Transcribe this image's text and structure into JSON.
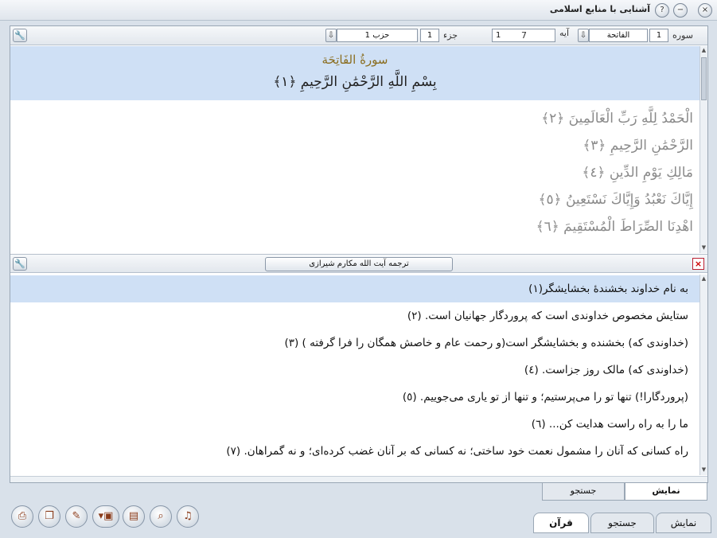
{
  "window": {
    "title": "آشنایی با منابع اسلامی"
  },
  "quran_toolbar": {
    "surah_label": "سوره",
    "surah_number": "1",
    "surah_name": "الفاتحة",
    "ayah_label": "آیه",
    "ayah_value": "1",
    "ayah_total": "7",
    "juz_label": "جزء",
    "juz_value": "1",
    "hizb_value": "حزب 1"
  },
  "quran": {
    "surah_title": "سورةُ الفَاتِحَة",
    "basmala": "بِسْمِ اللَّهِ الرَّحْمَٰنِ الرَّحِيمِ ﴿١﴾",
    "ayat": [
      "الْحَمْدُ لِلَّهِ رَبِّ الْعَالَمِينَ ﴿٢﴾",
      "الرَّحْمَٰنِ الرَّحِيمِ ﴿٣﴾",
      "مَالِكِ يَوْمِ الدِّينِ ﴿٤﴾",
      "إِيَّاكَ نَعْبُدُ وَإِيَّاكَ نَسْتَعِينُ ﴿٥﴾",
      "اهْدِنَا الصِّرَاطَ الْمُسْتَقِيمَ ﴿٦﴾"
    ]
  },
  "translation": {
    "translator": "ترجمه آیت الله مکارم شیرازی",
    "lines": [
      "به نام خداوند بخشندهٔ بخشایشگر(١)",
      "ستایش مخصوص خداوندی است که پروردگار جهانیان است. (٢)",
      "(خداوندی که) بخشنده و بخشایشگر است(و رحمت عام و خاصش همگان را فرا گرفته ) (٣)",
      "(خداوندی که) مالک روز جزاست. (٤)",
      "(پروردگارا!) تنها تو را می‌پرستیم؛ و تنها از تو یاری می‌جوییم. (٥)",
      "ما را به راه راست هدایت کن... (٦)",
      "راه کسانی که آنان را مشمول نعمت خود ساختی؛ نه کسانی که بر آنان غضب کرده‌ای؛ و نه گمراهان. (٧)"
    ]
  },
  "inner_tabs": {
    "display": "نمایش",
    "search": "جستجو"
  },
  "bottom_tabs": {
    "display": "نمایش",
    "search": "جستجو",
    "quran": "قرآن"
  },
  "icons": {
    "help": "?",
    "minimize": "−",
    "close": "×",
    "down_arrow": "⇩",
    "wrench": "🔧",
    "close_red": "×"
  }
}
